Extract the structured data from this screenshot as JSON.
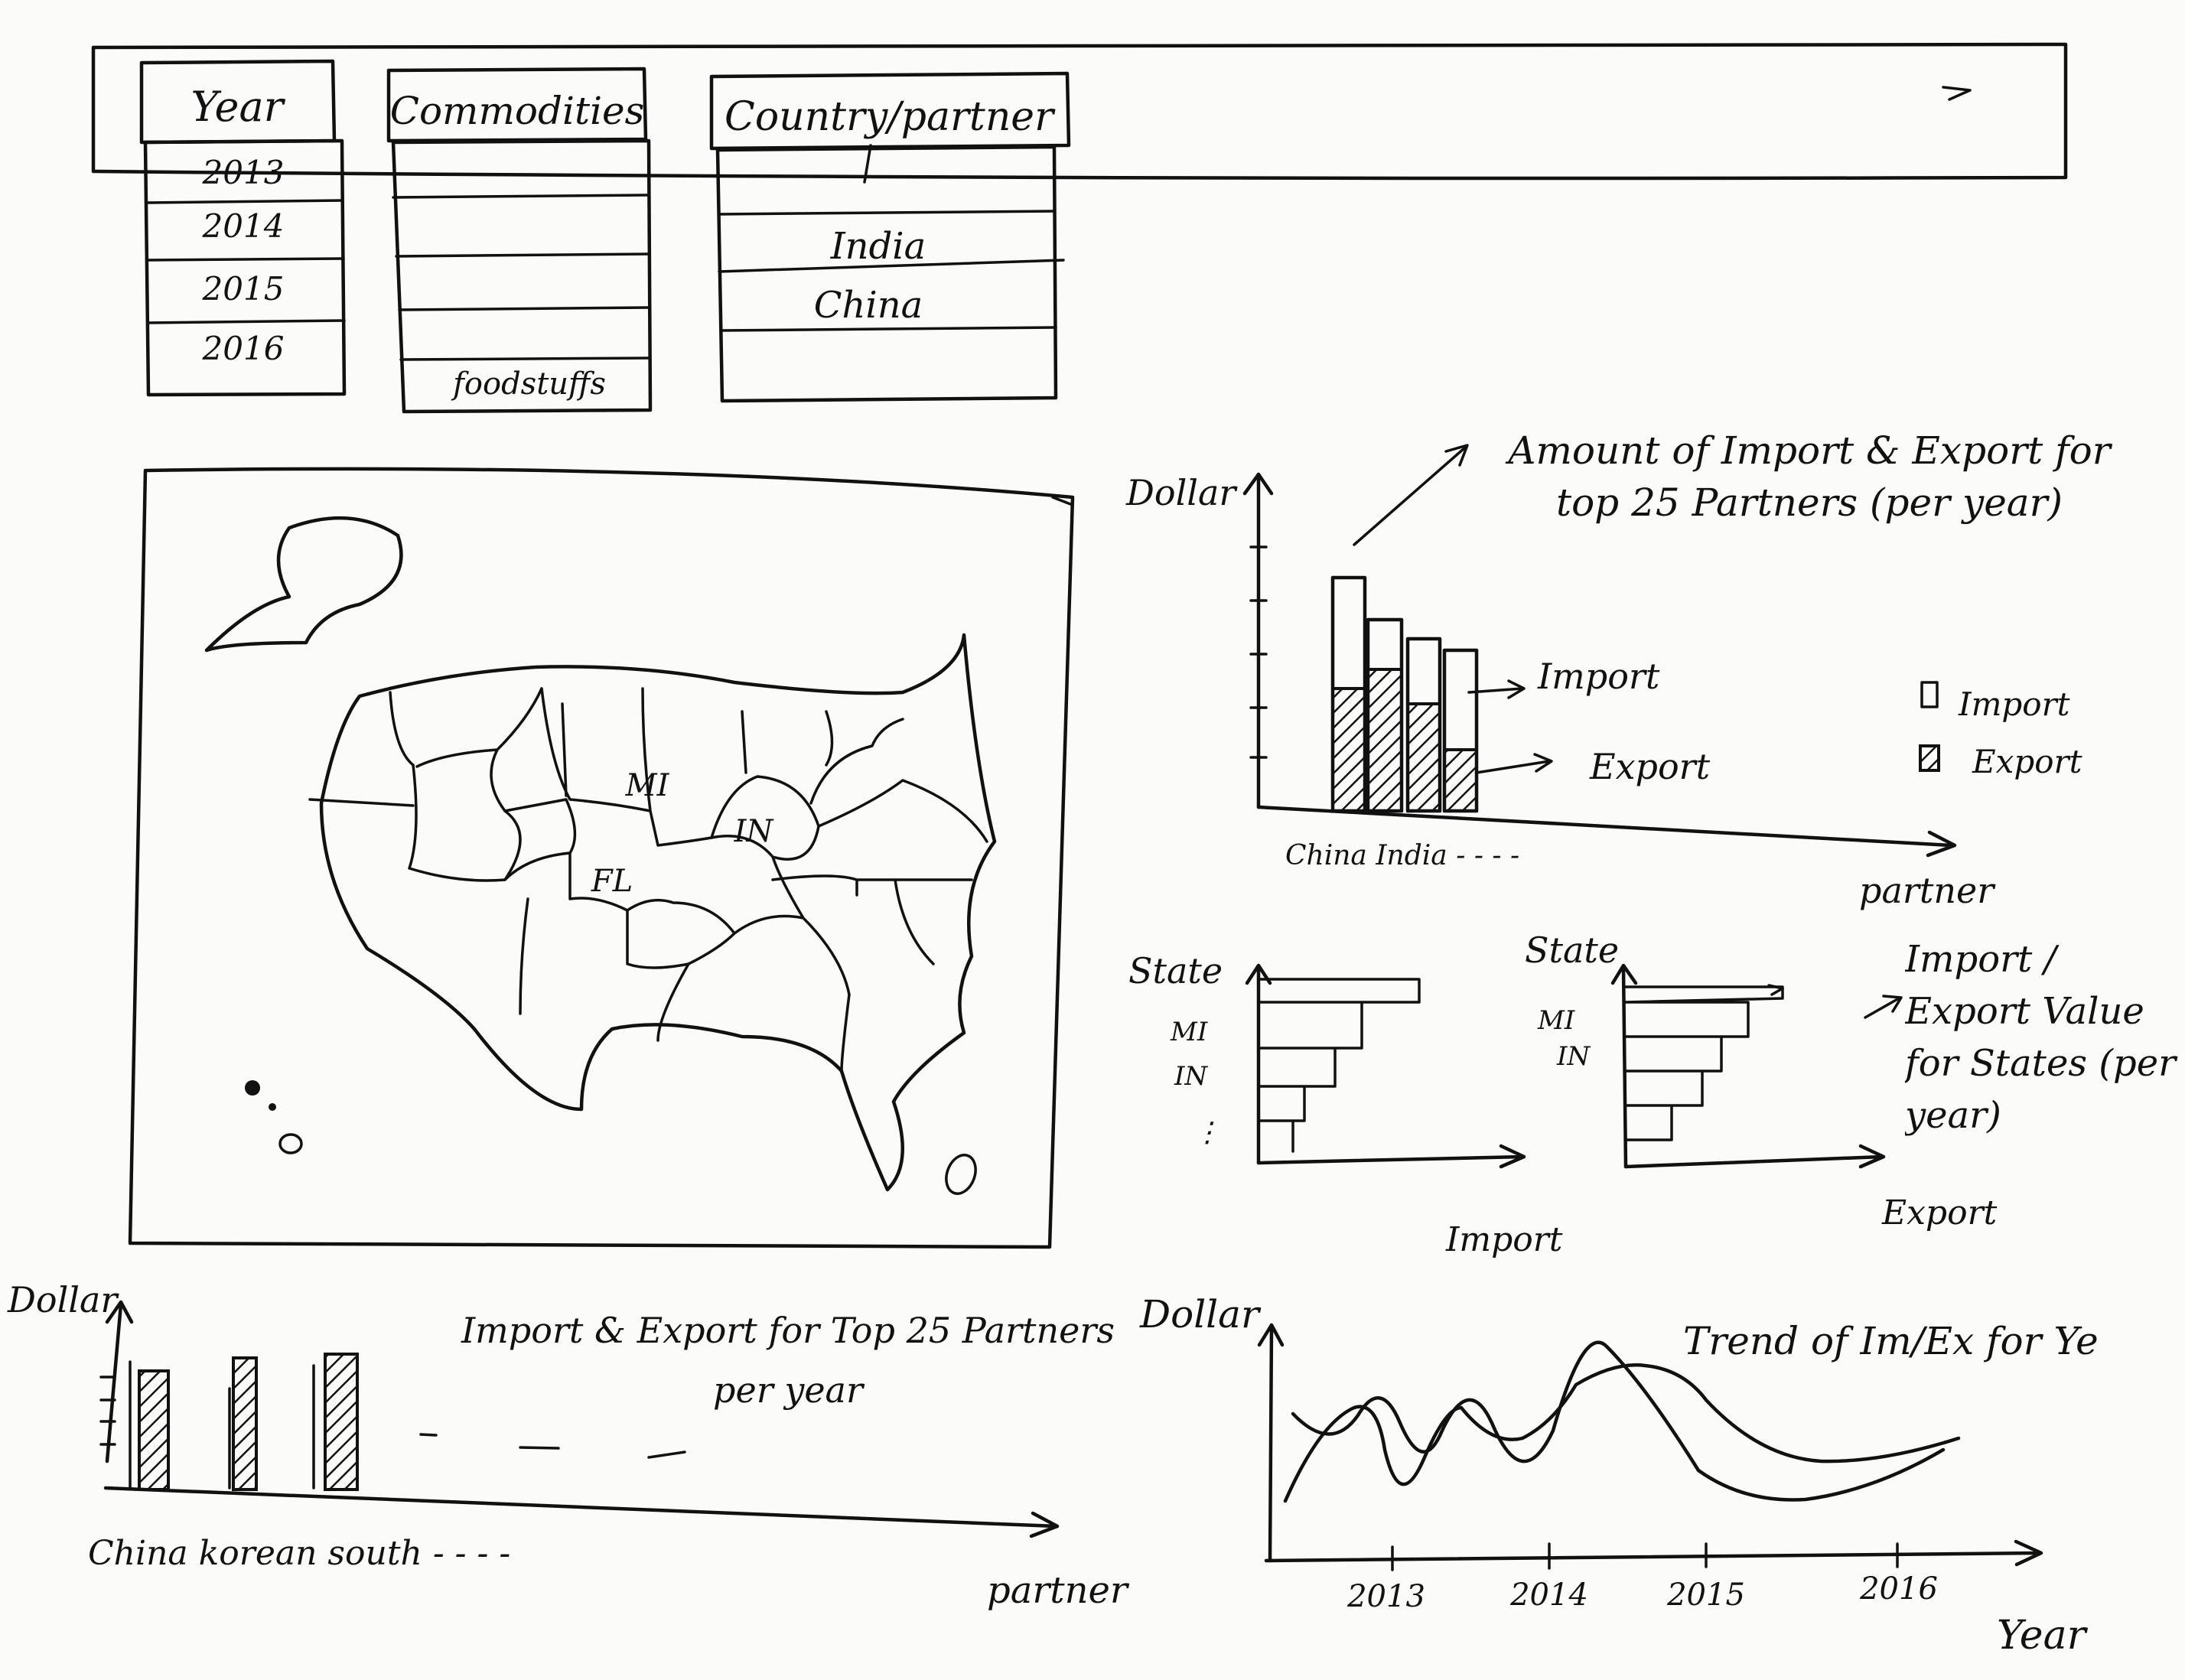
{
  "filters": {
    "year": {
      "header": "Year",
      "items": [
        "2013",
        "2014",
        "2015",
        "2016"
      ]
    },
    "commodities": {
      "header": "Commodities",
      "items": [
        "",
        "",
        "",
        "",
        "foodstuffs"
      ]
    },
    "country": {
      "header": "Country/partner",
      "items": [
        "",
        "India",
        "China",
        ""
      ]
    }
  },
  "map": {
    "state_labels": [
      "MI",
      "FL",
      "IN"
    ]
  },
  "top_chart": {
    "ylabel": "Dollar",
    "xlabel": "partner",
    "annotation_title": "Amount of Import & Export for top 25 Partners (per year)",
    "annotation_import": "Import",
    "annotation_export": "Export",
    "legend_import": "Import",
    "legend_export": "Export",
    "tick_labels": "China India - - - -"
  },
  "state_charts": {
    "import_ylabel": "State",
    "import_xlabel": "Import",
    "import_states": [
      "MI",
      "IN",
      "⋮"
    ],
    "export_ylabel": "State",
    "export_xlabel": "Export",
    "export_states": [
      "MI",
      "IN"
    ],
    "annotation": "Import / Export Value for States (per year)"
  },
  "bottom_left_chart": {
    "ylabel": "Dollar",
    "xlabel": "partner",
    "title": "Import & Export for Top 25 Partners per year",
    "tick_labels": "China korean south - - - -"
  },
  "trend_chart": {
    "ylabel": "Dollar",
    "xlabel": "Year",
    "title": "Trend of Im/Ex for Ye",
    "ticks": [
      "2013",
      "2014",
      "2015",
      "2016"
    ]
  }
}
